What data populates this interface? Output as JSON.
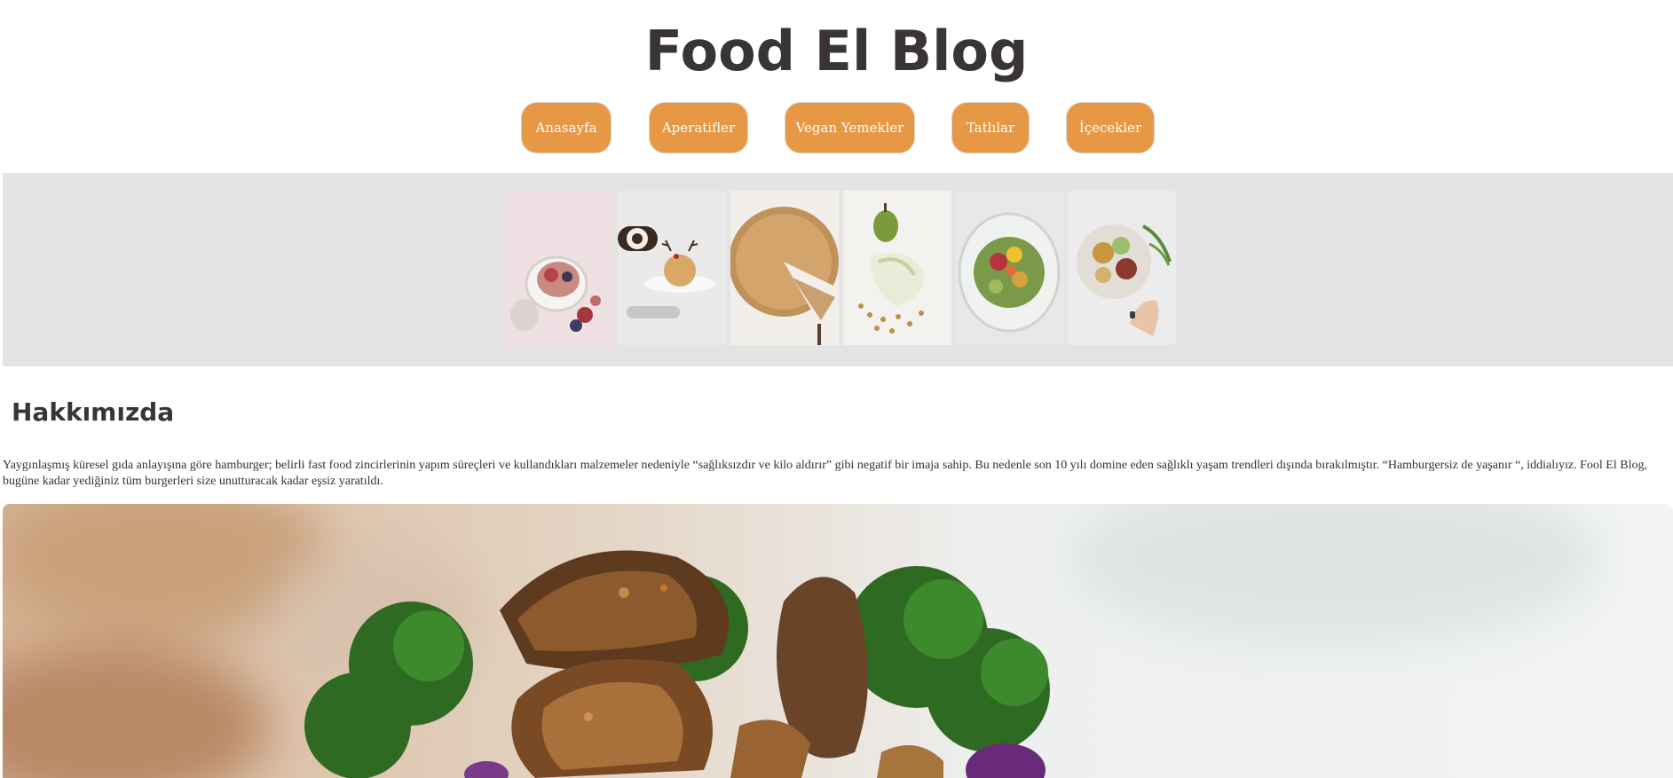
{
  "header": {
    "title": "Food El Blog"
  },
  "nav": {
    "items": [
      {
        "label": "Anasayfa"
      },
      {
        "label": "Aperatifler"
      },
      {
        "label": "Vegan Yemekler"
      },
      {
        "label": "Tatlılar"
      },
      {
        "label": "İçecekler"
      }
    ]
  },
  "about": {
    "heading": "Hakkımızda",
    "text": "Yaygınlaşmış küresel gıda anlayışına göre hamburger; belirli fast food zincirlerinin yapım süreçleri ve kullandıkları malzemeler nedeniyle “sağlıksızdır ve kilo aldırır” gibi negatif bir imaja sahip. Bu nedenle son 10 yılı domine eden sağlıklı yaşam trendleri dışında bırakılmıştır. “Hamburgersiz de yaşanır “, iddialıyız. Fool El Blog, bugüne kadar yediğiniz tüm burgerleri size unutturacak kadar eşsiz yaratıldı."
  },
  "colors": {
    "accent": "#e69845",
    "title": "#3a3535",
    "band": "#e4e4e4"
  }
}
